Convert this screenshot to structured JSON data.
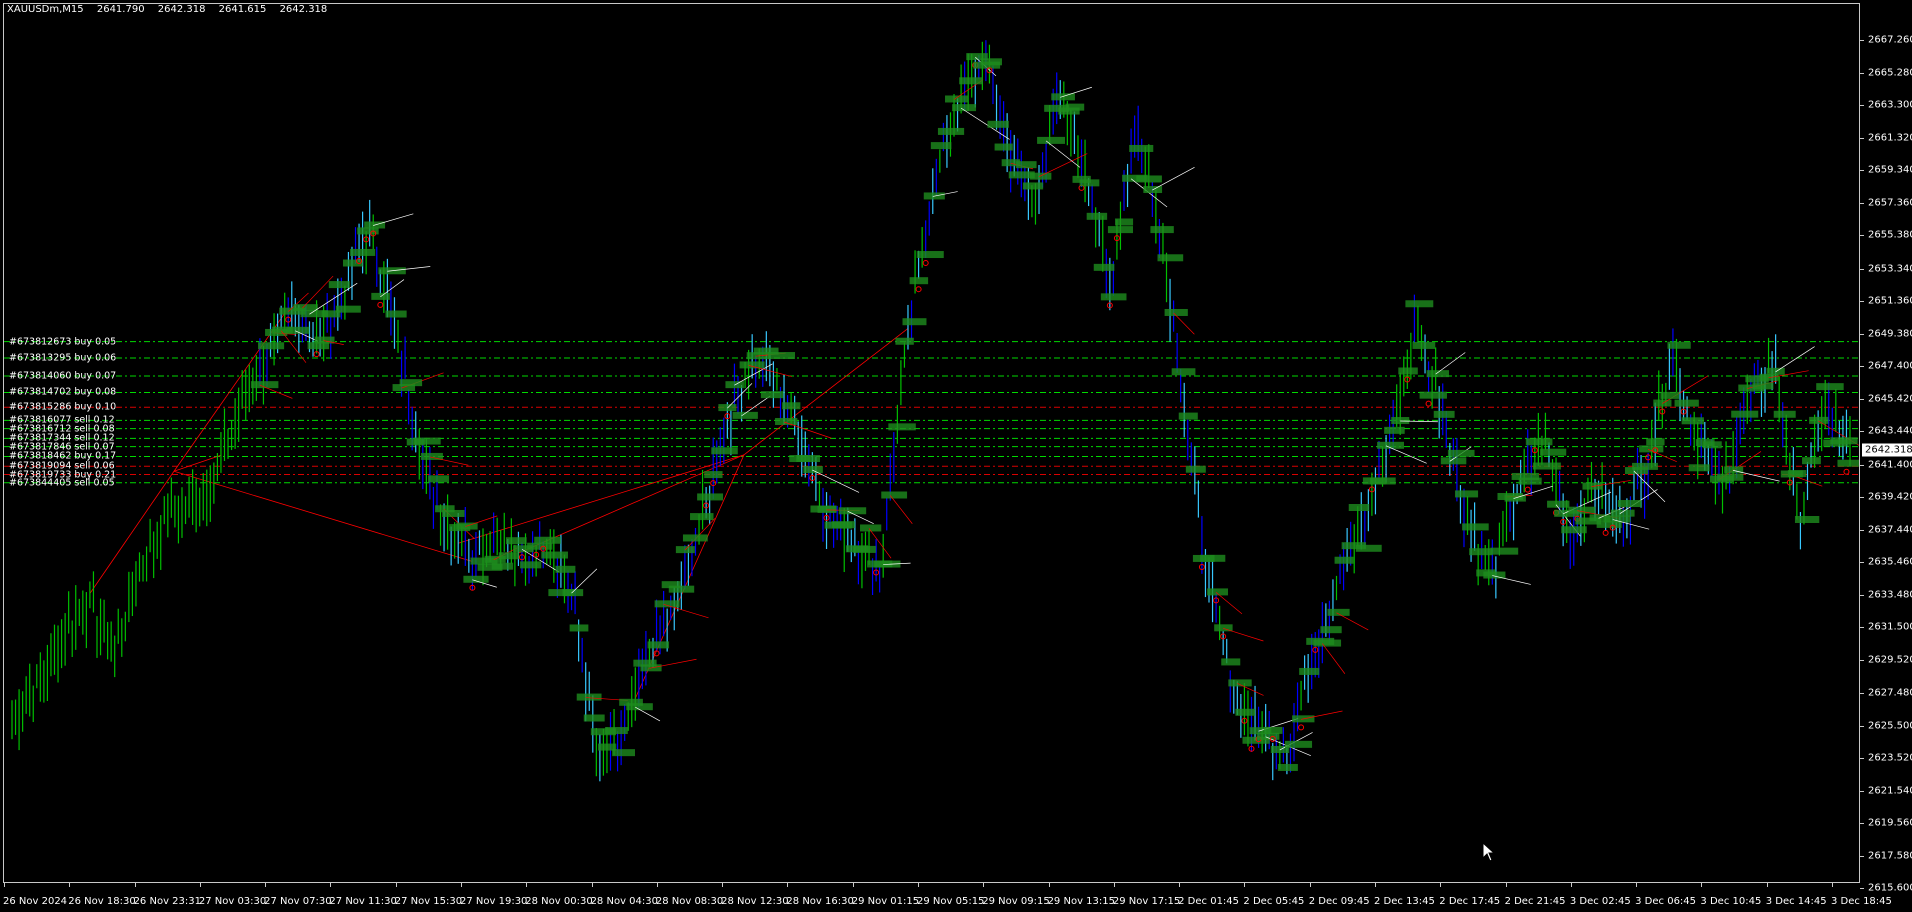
{
  "header": {
    "symbol": "XAUUSDm,M15",
    "ohlc": [
      "2641.790",
      "2642.318",
      "2641.615",
      "2642.318"
    ]
  },
  "price_axis": {
    "min": 2615.6,
    "max": 2668.5,
    "ticks": [
      "2667.260",
      "2665.280",
      "2663.300",
      "2661.320",
      "2659.340",
      "2657.360",
      "2655.380",
      "2653.340",
      "2651.360",
      "2649.380",
      "2647.400",
      "2645.420",
      "2643.440",
      "2641.400",
      "2639.420",
      "2637.440",
      "2635.460",
      "2633.480",
      "2631.500",
      "2629.520",
      "2627.480",
      "2625.500",
      "2623.520",
      "2621.540",
      "2619.560",
      "2617.580",
      "2615.600"
    ]
  },
  "time_axis": {
    "ticks": [
      "26 Nov 2024",
      "26 Nov 18:30",
      "26 Nov 23:31",
      "27 Nov 03:30",
      "27 Nov 07:30",
      "27 Nov 11:30",
      "27 Nov 15:30",
      "27 Nov 19:30",
      "28 Nov 00:30",
      "28 Nov 04:30",
      "28 Nov 08:30",
      "28 Nov 12:30",
      "28 Nov 16:30",
      "29 Nov 01:15",
      "29 Nov 05:15",
      "29 Nov 09:15",
      "29 Nov 13:15",
      "29 Nov 17:15",
      "2 Dec 01:45",
      "2 Dec 05:45",
      "2 Dec 09:45",
      "2 Dec 13:45",
      "2 Dec 17:45",
      "2 Dec 21:45",
      "3 Dec 02:45",
      "3 Dec 06:45",
      "3 Dec 10:45",
      "3 Dec 14:45",
      "3 Dec 18:45"
    ]
  },
  "current_price": "2642.318",
  "orders": [
    {
      "label": "#673812673 buy 0.05",
      "price": 2648.9,
      "color": "#00ff00"
    },
    {
      "label": "#673813295 buy 0.06",
      "price": 2647.9,
      "color": "#00ff00"
    },
    {
      "label": "#673814060 buy 0.07",
      "price": 2646.8,
      "color": "#00ff00"
    },
    {
      "label": "#673814702 buy 0.08",
      "price": 2645.8,
      "color": "#00ff00"
    },
    {
      "label": "#673815286 buy 0.10",
      "price": 2644.9,
      "color": "#ff0000"
    },
    {
      "label": "#673816077 sell 0.12",
      "price": 2644.1,
      "color": "#00ff00"
    },
    {
      "label": "#673816712 sell 0.08",
      "price": 2643.6,
      "color": "#00ff00"
    },
    {
      "label": "#673817344 sell 0.12",
      "price": 2643.0,
      "color": "#00ff00"
    },
    {
      "label": "#673817846 sell 0.07",
      "price": 2642.5,
      "color": "#00ff00"
    },
    {
      "label": "#673818462 buy 0.17",
      "price": 2641.9,
      "color": "#00ff00"
    },
    {
      "label": "#673819094 sell 0.06",
      "price": 2641.3,
      "color": "#ff0000"
    },
    {
      "label": "#673819733 buy 0.21",
      "price": 2640.8,
      "color": "#ff0000"
    },
    {
      "label": "#673844405 sell 0.05",
      "price": 2640.3,
      "color": "#00ff00"
    }
  ],
  "chart_data": {
    "type": "line",
    "series": [
      {
        "values": [
          2626,
          2628,
          2631,
          2633,
          2630,
          2635,
          2638,
          2639,
          2641,
          2645,
          2648,
          2651,
          2649,
          2652,
          2656,
          2650,
          2642,
          2638,
          2636,
          2637,
          2635,
          2637,
          2633,
          2623,
          2625,
          2630,
          2633,
          2638,
          2644,
          2648,
          2646,
          2643,
          2638,
          2637,
          2635,
          2648,
          2658,
          2663,
          2666,
          2661,
          2657,
          2664,
          2660,
          2652,
          2662,
          2656,
          2644,
          2633,
          2627,
          2625,
          2624,
          2630,
          2635,
          2638,
          2643,
          2650,
          2645,
          2638,
          2635,
          2640,
          2643,
          2637,
          2640,
          2638,
          2641,
          2648,
          2643,
          2640,
          2645,
          2648,
          2638,
          2645,
          2642
        ]
      }
    ],
    "ylim": [
      2615.6,
      2668.5
    ],
    "grid": false,
    "colors": {
      "up": "#00c000",
      "buy": "#0000ff",
      "sell": "#ff0000",
      "label": "#1e8c1e"
    }
  }
}
